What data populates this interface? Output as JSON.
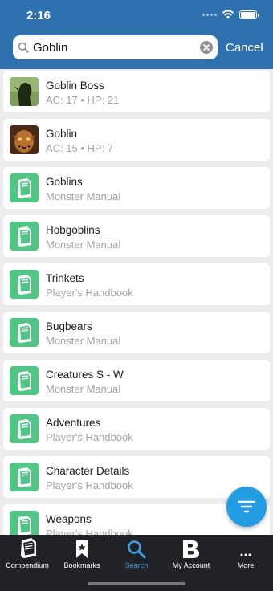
{
  "status_bar": {
    "time": "2:16"
  },
  "search": {
    "query": "Goblin",
    "cancel_label": "Cancel"
  },
  "colors": {
    "header": "#2f70ae",
    "book_icon": "#4fc683",
    "accent": "#229ce3",
    "tabbar": "#202226"
  },
  "results": [
    {
      "title": "Goblin Boss",
      "subtitle": "AC: 17 • HP: 21",
      "icon": "goblin-boss-portrait"
    },
    {
      "title": "Goblin",
      "subtitle": "AC: 15 • HP: 7",
      "icon": "goblin-portrait"
    },
    {
      "title": "Goblins",
      "subtitle": "Monster Manual",
      "icon": "book-icon"
    },
    {
      "title": "Hobgoblins",
      "subtitle": "Monster Manual",
      "icon": "book-icon"
    },
    {
      "title": "Trinkets",
      "subtitle": "Player's Handbook",
      "icon": "book-icon"
    },
    {
      "title": "Bugbears",
      "subtitle": "Monster Manual",
      "icon": "book-icon"
    },
    {
      "title": "Creatures S - W",
      "subtitle": "Monster Manual",
      "icon": "book-icon"
    },
    {
      "title": "Adventures",
      "subtitle": "Player's Handbook",
      "icon": "book-icon"
    },
    {
      "title": "Character Details",
      "subtitle": "Player's Handbook",
      "icon": "book-icon"
    },
    {
      "title": "Weapons",
      "subtitle": "Player's Handbook",
      "icon": "book-icon"
    }
  ],
  "fab": {
    "icon": "filter-icon"
  },
  "tabs": [
    {
      "label": "Compendium",
      "icon": "compendium-icon",
      "active": false
    },
    {
      "label": "Bookmarks",
      "icon": "bookmark-icon",
      "active": false
    },
    {
      "label": "Search",
      "icon": "search-icon",
      "active": true
    },
    {
      "label": "My Account",
      "icon": "dndbeyond-b-icon",
      "active": false
    },
    {
      "label": "More",
      "icon": "more-icon",
      "active": false
    }
  ]
}
